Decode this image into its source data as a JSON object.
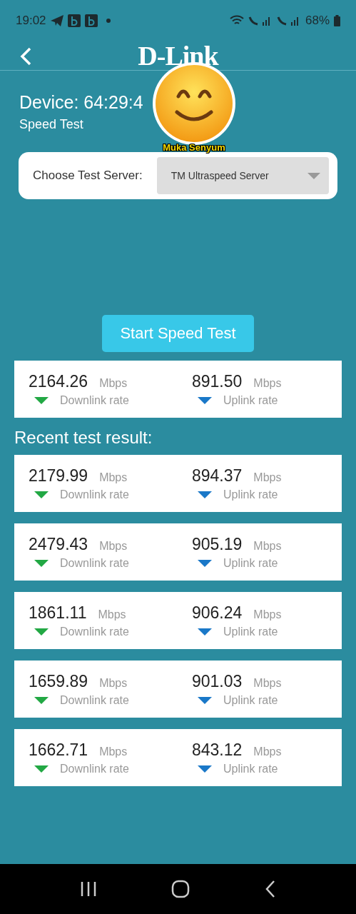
{
  "status_bar": {
    "time": "19:02",
    "battery": "68%"
  },
  "header": {
    "logo": "D-Link"
  },
  "device": {
    "title": "Device: 64:29:4",
    "subtitle": "Speed Test"
  },
  "sticker": {
    "caption": "Muka Senyum"
  },
  "server": {
    "label": "Choose Test Server:",
    "value": "TM Ultraspeed Server"
  },
  "start_button": "Start Speed Test",
  "current": {
    "down": {
      "value": "2164.26",
      "unit": "Mbps",
      "label": "Downlink rate"
    },
    "up": {
      "value": "891.50",
      "unit": "Mbps",
      "label": "Uplink rate"
    }
  },
  "recent_title": "Recent test result:",
  "recent": [
    {
      "down": {
        "value": "2179.99",
        "unit": "Mbps",
        "label": "Downlink rate"
      },
      "up": {
        "value": "894.37",
        "unit": "Mbps",
        "label": "Uplink rate"
      }
    },
    {
      "down": {
        "value": "2479.43",
        "unit": "Mbps",
        "label": "Downlink rate"
      },
      "up": {
        "value": "905.19",
        "unit": "Mbps",
        "label": "Uplink rate"
      }
    },
    {
      "down": {
        "value": "1861.11",
        "unit": "Mbps",
        "label": "Downlink rate"
      },
      "up": {
        "value": "906.24",
        "unit": "Mbps",
        "label": "Uplink rate"
      }
    },
    {
      "down": {
        "value": "1659.89",
        "unit": "Mbps",
        "label": "Downlink rate"
      },
      "up": {
        "value": "901.03",
        "unit": "Mbps",
        "label": "Uplink rate"
      }
    },
    {
      "down": {
        "value": "1662.71",
        "unit": "Mbps",
        "label": "Downlink rate"
      },
      "up": {
        "value": "843.12",
        "unit": "Mbps",
        "label": "Uplink rate"
      }
    }
  ]
}
